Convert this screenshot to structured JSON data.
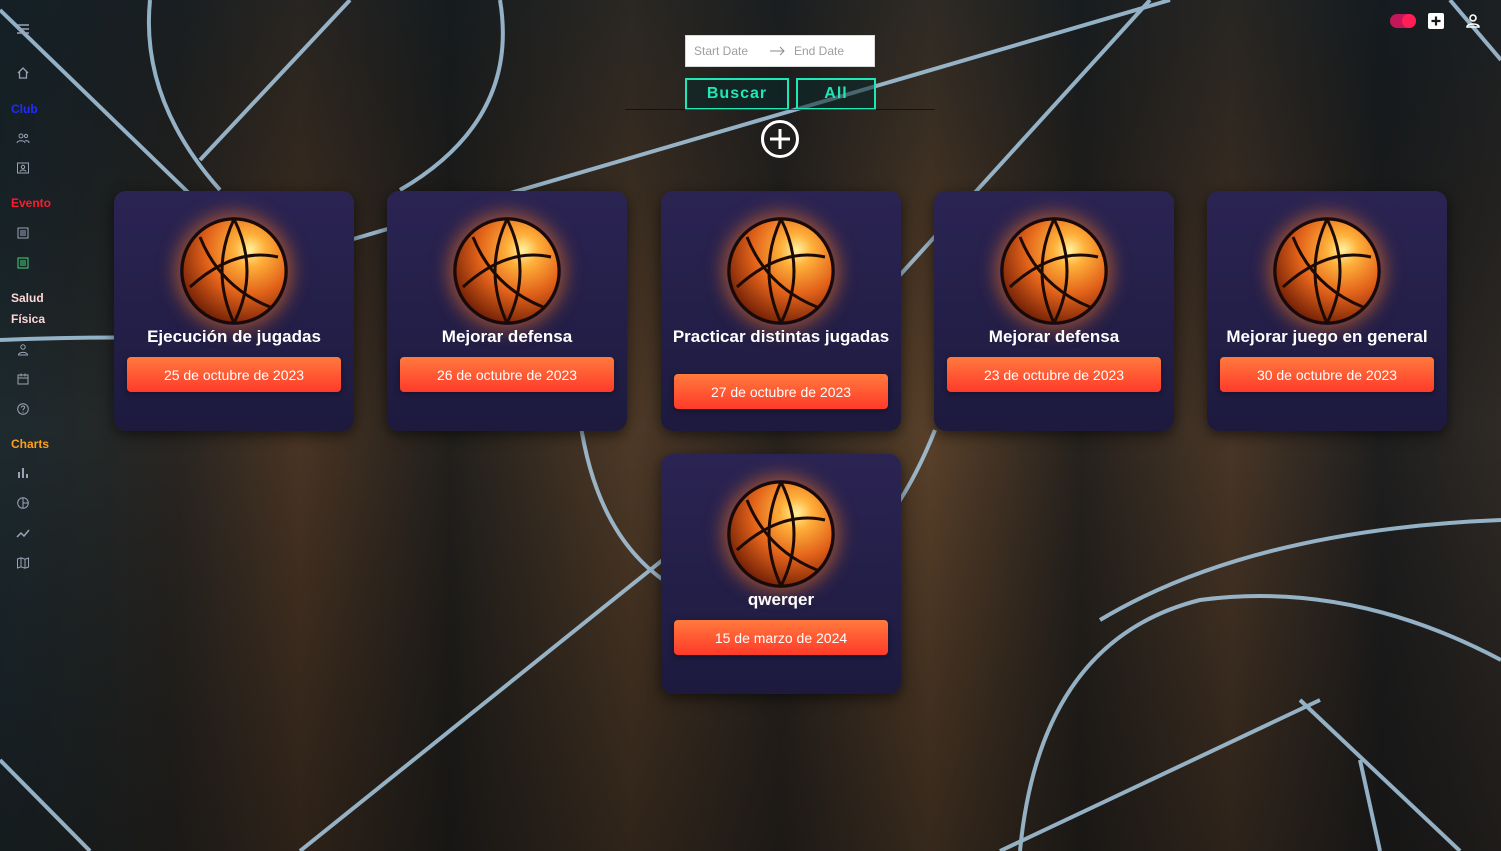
{
  "sidebar": {
    "sections": {
      "club": "Club",
      "evento": "Evento",
      "salud_1": "Salud",
      "salud_2": "Física",
      "charts": "Charts"
    },
    "icons": [
      "menu-icon",
      "home-icon",
      "group-icon",
      "contact-card-icon",
      "list-icon",
      "list-active-icon",
      "person-icon",
      "calendar-icon",
      "help-icon",
      "bar-chart-icon",
      "pie-chart-icon",
      "line-chart-icon",
      "map-icon"
    ],
    "colors": {
      "club": "#1f2dff",
      "evento": "#ff1a2e",
      "salud": "#ffd6d6",
      "charts": "#ff9f1a",
      "active_icon": "#44d17a"
    }
  },
  "header": {
    "icons": [
      "theme-toggle",
      "add-box-icon",
      "account-icon"
    ]
  },
  "filter": {
    "start_placeholder": "Start Date",
    "end_placeholder": "End Date",
    "search_label": "Buscar",
    "all_label": "All",
    "accent": "#1de9b6"
  },
  "cards": [
    {
      "title": "Ejecución de jugadas",
      "date": "25 de octubre de 2023"
    },
    {
      "title": "Mejorar defensa",
      "date": "26 de octubre de 2023"
    },
    {
      "title": "Practicar distintas jugadas",
      "date": "27 de octubre de 2023"
    },
    {
      "title": "Mejorar defensa",
      "date": "23 de octubre de 2023"
    },
    {
      "title": "Mejorar juego en general",
      "date": "30 de octubre de 2023"
    },
    {
      "title": "qwerqer",
      "date": "15 de marzo de 2024"
    }
  ]
}
